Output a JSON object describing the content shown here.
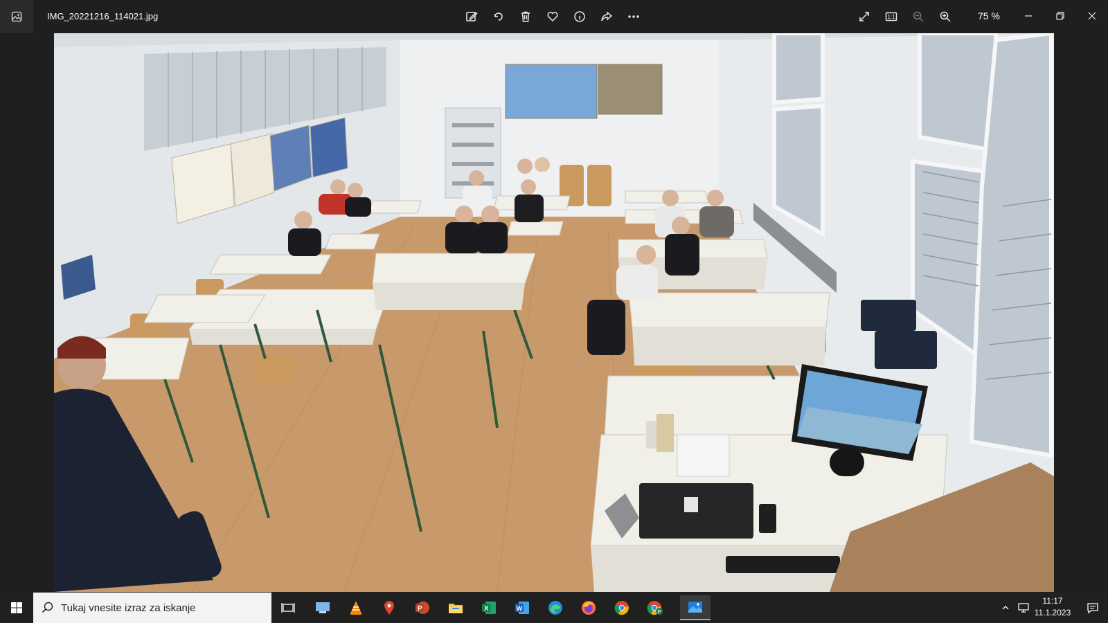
{
  "window": {
    "filename": "IMG_20221216_114021.jpg",
    "zoom": "75 %"
  },
  "toolbar": {
    "icons": [
      "edit-icon",
      "rotate-icon",
      "delete-icon",
      "favorite-icon",
      "info-icon",
      "share-icon",
      "more-icon"
    ],
    "view_icons": [
      "fullscreen-icon",
      "actual-size-icon",
      "zoom-out-icon",
      "zoom-in-icon"
    ],
    "actual_size_label": "1:1"
  },
  "photo": {
    "description_icon": "photo-image",
    "colors": {
      "wall": "#e9ecee",
      "floor": "#c79a66",
      "desk": "#efeee8",
      "desk_frame": "#2f5a3a",
      "chair": "#c9995e"
    }
  },
  "taskbar": {
    "search_placeholder": "Tukaj vnesite izraz za iskanje",
    "apps": [
      "task-view-icon",
      "remote-desktop-icon",
      "vlc-icon",
      "maps-icon",
      "powerpoint-icon",
      "file-explorer-icon",
      "excel-icon",
      "word-icon",
      "edge-icon",
      "firefox-icon",
      "chrome-icon",
      "chrome-profile-icon",
      "photos-icon"
    ],
    "time": "11:17",
    "date": "11.1.2023"
  }
}
